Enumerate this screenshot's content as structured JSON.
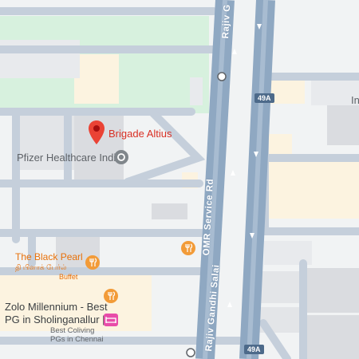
{
  "map": {
    "colors": {
      "background": "#f1f3f4",
      "road_minor": "#c5cfdb",
      "road_major": "#8fa8c2",
      "park": "#d7f1de",
      "building": "#dadce0",
      "commercial": "#fcf3e0",
      "pin_red": "#ea4335",
      "poi_orange": "#f29b38",
      "poi_grey": "#80868b",
      "hotel_pink": "#e84ca9"
    },
    "roads": [
      {
        "label": "Rajiv Gandhi Salai",
        "type": "highway"
      },
      {
        "label": "OMR Service Rd",
        "type": "service-road"
      }
    ],
    "road_labels": {
      "top": "Rajiv G",
      "omr": "OMR Service Rd",
      "bottom": "Rajiv Gandhi Salai"
    },
    "shields": [
      "49A",
      "49A"
    ],
    "places": {
      "brigade": {
        "name": "Brigade Altius",
        "icon": "location-pin-icon"
      },
      "pfizer": {
        "name": "Pfizer Healthcare India",
        "icon": "office-pin-icon"
      },
      "black_pearl": {
        "name": "The Black Pearl",
        "name_local": "தி பிளாக் பேர்ல்",
        "subtitle": "Buffet",
        "icon": "restaurant-icon"
      },
      "zolo": {
        "name_line1": "Zolo Millennium - Best",
        "name_line2": "PG in Sholinganallur | ...",
        "subtitle_line1": "Best Coliving",
        "subtitle_line2": "PGs in Chennai",
        "icon": "hotel-icon"
      },
      "partial": {
        "name": "In"
      }
    },
    "markers": [
      "restaurant-icon",
      "restaurant-icon"
    ]
  }
}
